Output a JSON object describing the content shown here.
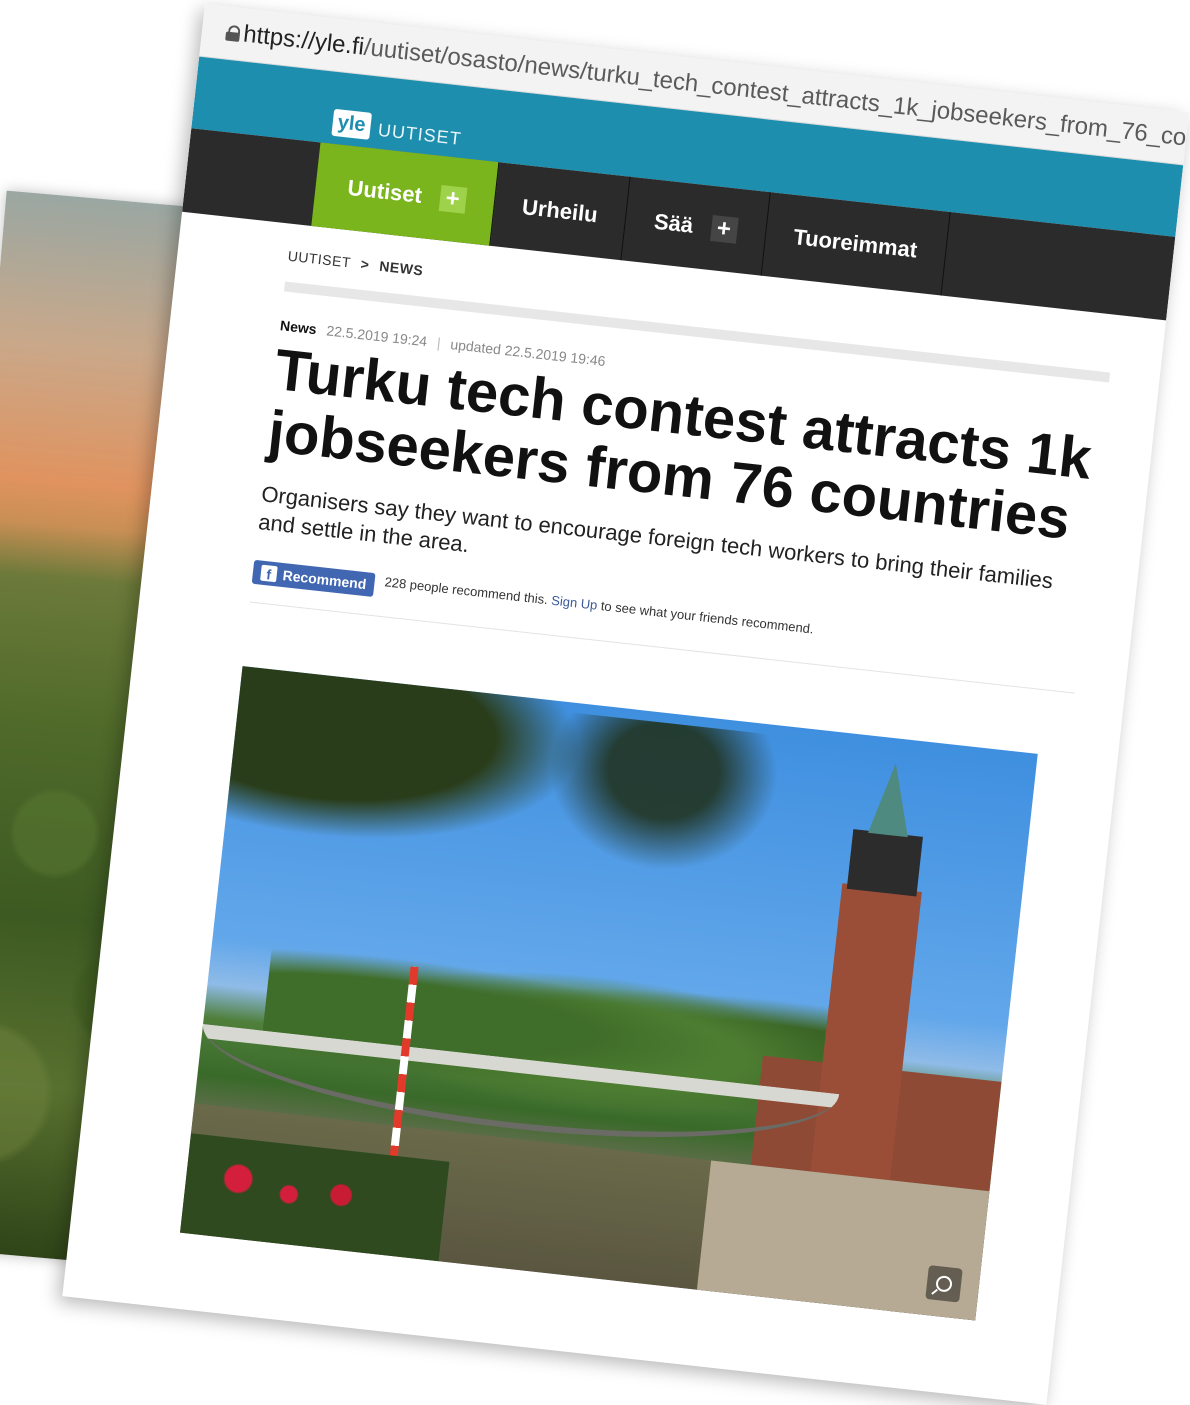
{
  "browser": {
    "url_host": "https://yle.fi",
    "url_path": "/uutiset/osasto/news/turku_tech_contest_attracts_1k_jobseekers_from_76_co"
  },
  "site": {
    "logo": "yle",
    "section": "UUTISET"
  },
  "nav": {
    "items": [
      {
        "label": "Uutiset",
        "plus": "+"
      },
      {
        "label": "Urheilu"
      },
      {
        "label": "Sää",
        "plus": "+"
      },
      {
        "label": "Tuoreimmat"
      }
    ]
  },
  "breadcrumb": {
    "root": "UUTISET",
    "separator": ">",
    "current": "NEWS"
  },
  "article": {
    "category": "News",
    "published": "22.5.2019 19:24",
    "separator": "|",
    "updated": "updated 22.5.2019 19:46",
    "headline": "Turku tech contest attracts 1k jobseekers from 76 countries",
    "lead": "Organisers say they want to encourage foreign tech workers to bring their families and settle in the area."
  },
  "facebook": {
    "button_label": "Recommend",
    "icon": "f",
    "count_text": "228 people recommend this.",
    "signup_link": "Sign Up",
    "after_text": "to see what your friends recommend."
  },
  "colors": {
    "yle_blue": "#1d8eae",
    "nav_active": "#7ab51d",
    "nav_dark": "#2b2b2b",
    "facebook": "#4267b2"
  },
  "icons": {
    "lock": "lock-icon",
    "plus": "plus-icon",
    "facebook": "facebook-icon",
    "zoom": "zoom-icon"
  }
}
